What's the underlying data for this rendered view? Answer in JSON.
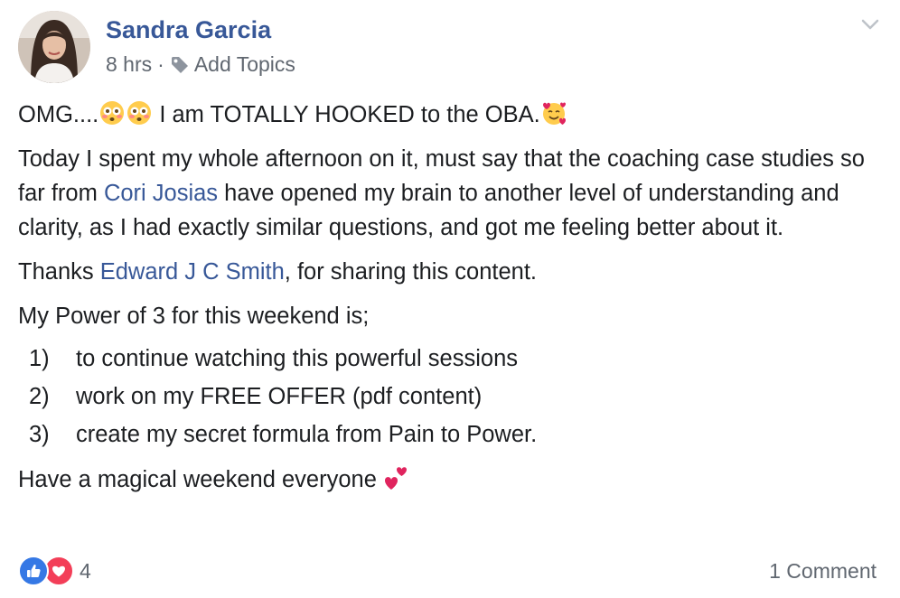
{
  "post": {
    "author": "Sandra Garcia",
    "time": "8 hrs",
    "separator": "·",
    "add_topics": "Add Topics",
    "line1": {
      "text_a": "OMG....",
      "text_b": " I am TOTALLY HOOKED to the OBA."
    },
    "para2": {
      "text_a": "Today I spent my whole afternoon on it, must say that the coaching case studies so far from ",
      "mention": "Cori Josias",
      "text_b": " have opened my brain to another level of understanding and clarity, as I had exactly similar questions, and got me feeling better about it."
    },
    "para3": {
      "text_a": "Thanks ",
      "mention": "Edward J C Smith",
      "text_b": ", for sharing this content."
    },
    "para4": "My Power of 3 for this weekend is;",
    "list": [
      {
        "num": "1)",
        "text": "to continue watching this powerful sessions"
      },
      {
        "num": "2)",
        "text": "work on my FREE OFFER (pdf content)"
      },
      {
        "num": "3)",
        "text": "create my secret formula from Pain to Power."
      }
    ],
    "closing": "Have a magical weekend everyone "
  },
  "footer": {
    "reaction_count": "4",
    "comments": "1 Comment"
  },
  "icons": {
    "tag": "tag-icon",
    "chevron": "chevron-down-icon",
    "like": "like-icon",
    "love": "love-icon",
    "flushed": "flushed-face-emoji",
    "hearts_face": "smiling-face-with-hearts-emoji",
    "two_hearts": "two-hearts-emoji"
  },
  "colors": {
    "link": "#385898",
    "meta": "#606770",
    "like": "#3578e5",
    "love": "#f33e58"
  }
}
